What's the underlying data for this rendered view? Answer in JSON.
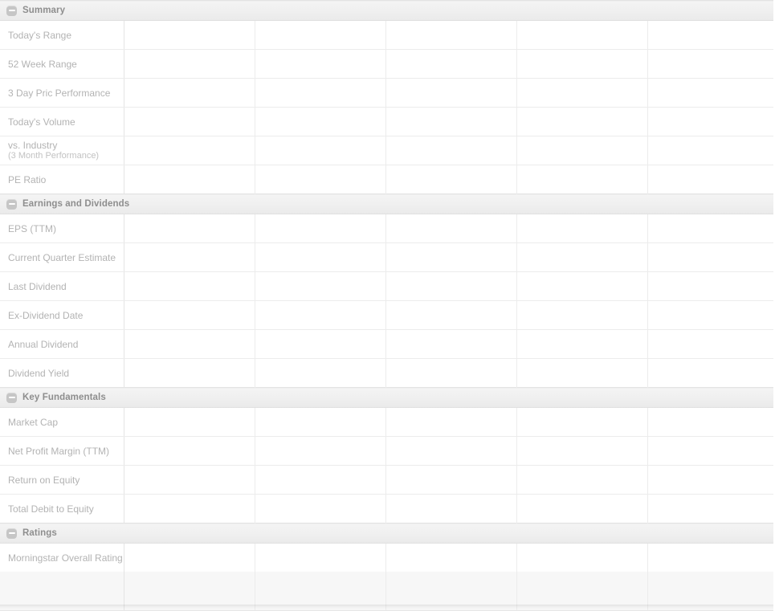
{
  "widget": {
    "name": "Stock Comparison Summary",
    "collapse_icon": "minus-square-icon",
    "column_count": 6,
    "colors": {
      "section_header_bg": "#efefef",
      "section_title_text": "#8e8e8e",
      "row_label_text": "#b3b3b3",
      "row_border": "#ececec",
      "label_divider": "#e4e4e4",
      "footer_row_bg": "#f7f7f7",
      "page_bg": "#ffffff"
    }
  },
  "sections": [
    {
      "id": "summary",
      "title": "Summary",
      "collapsed": false,
      "rows": [
        {
          "label": "Today's Range",
          "sublabel": "",
          "values": [
            "",
            "",
            "",
            "",
            ""
          ]
        },
        {
          "label": "52 Week Range",
          "sublabel": "",
          "values": [
            "",
            "",
            "",
            "",
            ""
          ]
        },
        {
          "label": "3 Day Pric Performance",
          "sublabel": "",
          "values": [
            "",
            "",
            "",
            "",
            ""
          ]
        },
        {
          "label": "Today's Volume",
          "sublabel": "",
          "values": [
            "",
            "",
            "",
            "",
            ""
          ]
        },
        {
          "label": "vs. Industry",
          "sublabel": "(3 Month Performance)",
          "values": [
            "",
            "",
            "",
            "",
            ""
          ]
        },
        {
          "label": "PE Ratio",
          "sublabel": "",
          "values": [
            "",
            "",
            "",
            "",
            ""
          ]
        }
      ]
    },
    {
      "id": "earnings-and-dividends",
      "title": "Earnings and Dividends",
      "collapsed": false,
      "rows": [
        {
          "label": "EPS (TTM)",
          "sublabel": "",
          "values": [
            "",
            "",
            "",
            "",
            ""
          ]
        },
        {
          "label": "Current Quarter Estimate",
          "sublabel": "",
          "values": [
            "",
            "",
            "",
            "",
            ""
          ]
        },
        {
          "label": "Last Dividend",
          "sublabel": "",
          "values": [
            "",
            "",
            "",
            "",
            ""
          ]
        },
        {
          "label": "Ex-Dividend Date",
          "sublabel": "",
          "values": [
            "",
            "",
            "",
            "",
            ""
          ]
        },
        {
          "label": "Annual Dividend",
          "sublabel": "",
          "values": [
            "",
            "",
            "",
            "",
            ""
          ]
        },
        {
          "label": "Dividend Yield",
          "sublabel": "",
          "values": [
            "",
            "",
            "",
            "",
            ""
          ]
        }
      ]
    },
    {
      "id": "key-fundamentals",
      "title": "Key Fundamentals",
      "collapsed": false,
      "rows": [
        {
          "label": "Market Cap",
          "sublabel": "",
          "values": [
            "",
            "",
            "",
            "",
            ""
          ]
        },
        {
          "label": "Net Profit Margin (TTM)",
          "sublabel": "",
          "values": [
            "",
            "",
            "",
            "",
            ""
          ]
        },
        {
          "label": "Return on Equity",
          "sublabel": "",
          "values": [
            "",
            "",
            "",
            "",
            ""
          ]
        },
        {
          "label": "Total Debit to Equity",
          "sublabel": "",
          "values": [
            "",
            "",
            "",
            "",
            ""
          ]
        }
      ]
    },
    {
      "id": "ratings",
      "title": "Ratings",
      "collapsed": false,
      "rows": [
        {
          "label": "Morningstar Overall Rating",
          "sublabel": "",
          "values": [
            "",
            "",
            "",
            "",
            ""
          ]
        }
      ]
    }
  ],
  "footer_row": {
    "label": "",
    "values": [
      "",
      "",
      "",
      "",
      ""
    ]
  }
}
